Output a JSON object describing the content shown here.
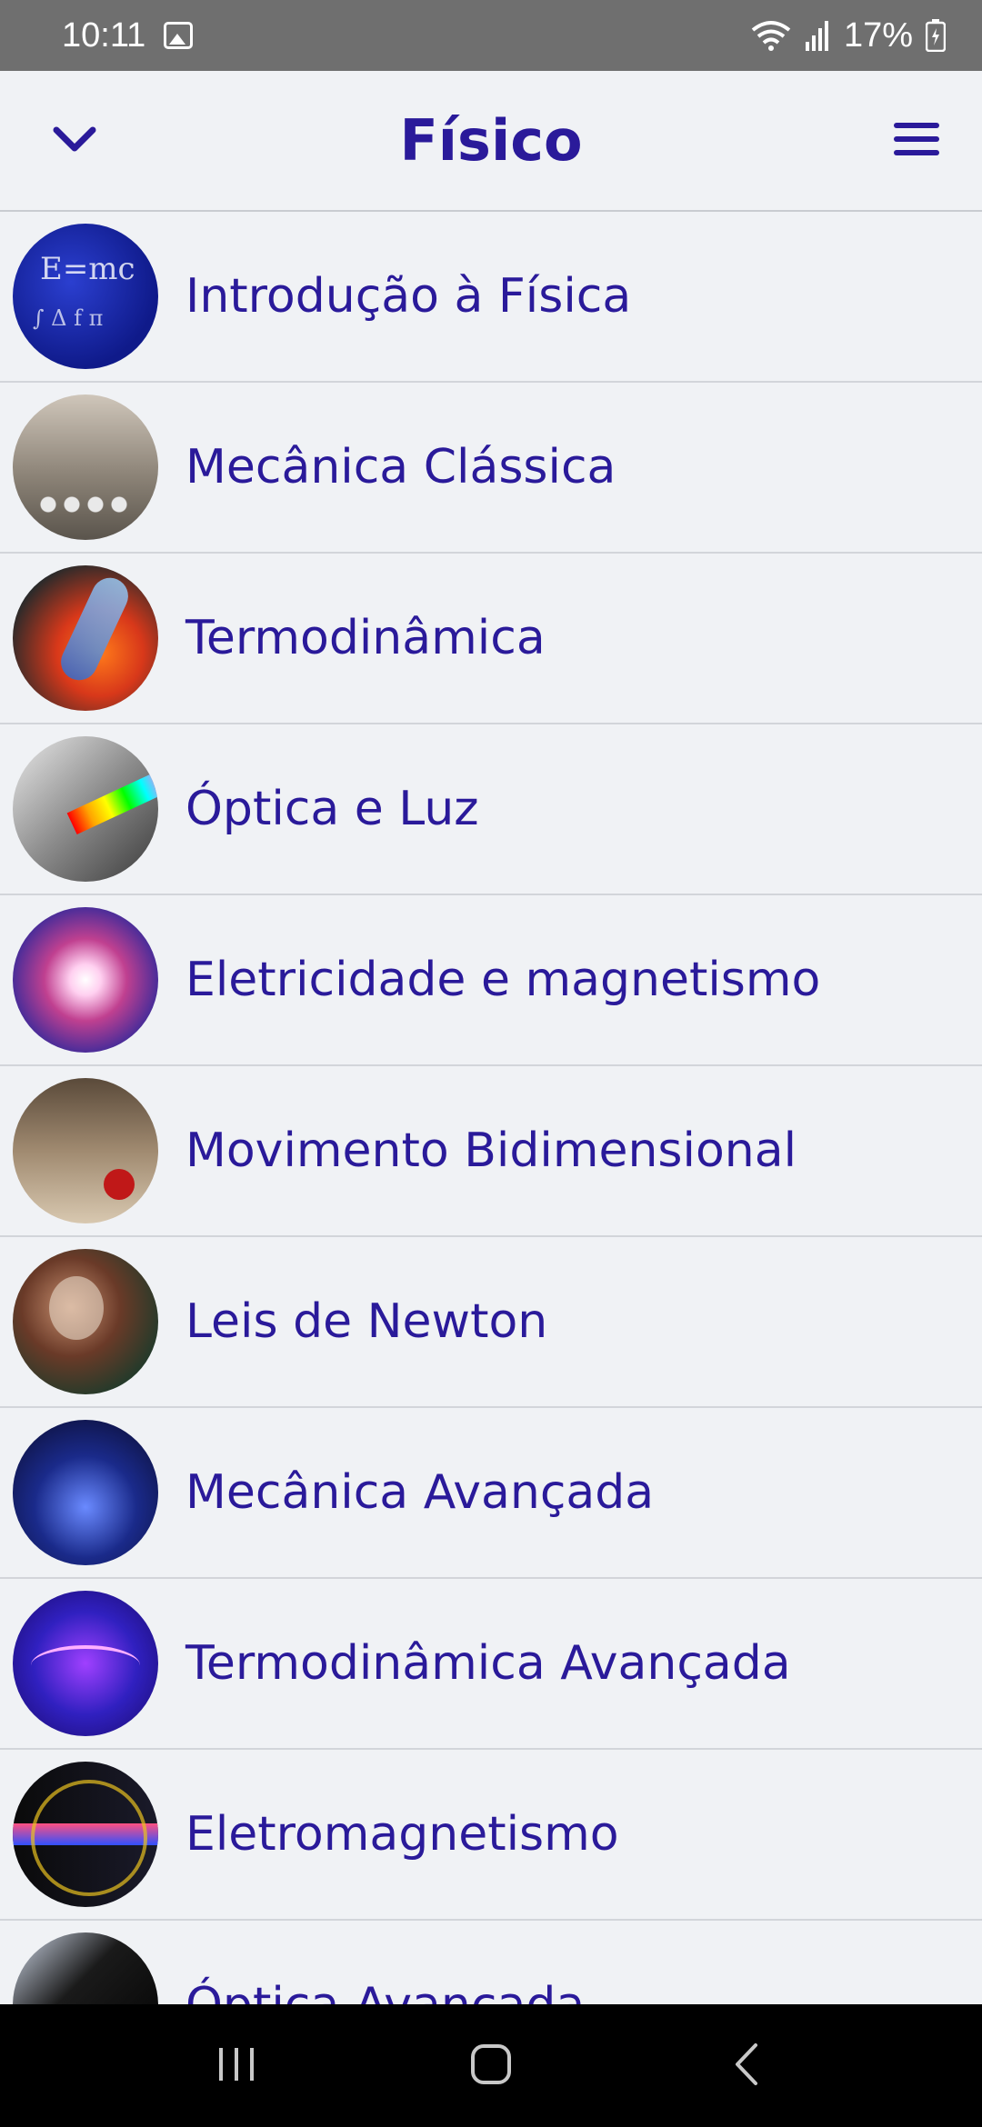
{
  "status_bar": {
    "time": "10:11",
    "battery_percent": "17%",
    "icons": [
      "gallery-icon",
      "wifi-icon",
      "signal-icon",
      "battery-icon"
    ]
  },
  "header": {
    "title": "Físico",
    "left_icon": "chevron-down-icon",
    "right_icon": "hamburger-menu-icon"
  },
  "colors": {
    "accent": "#2a1a9a",
    "background": "#f0f2f5",
    "status_bar": "#6f6f6f",
    "nav_bar": "#000000"
  },
  "topics": [
    {
      "label": "Introdução à Física"
    },
    {
      "label": "Mecânica Clássica"
    },
    {
      "label": "Termodinâmica"
    },
    {
      "label": "Óptica e Luz"
    },
    {
      "label": "Eletricidade e magnetismo"
    },
    {
      "label": "Movimento Bidimensional"
    },
    {
      "label": "Leis de Newton"
    },
    {
      "label": "Mecânica Avançada"
    },
    {
      "label": "Termodinâmica Avançada"
    },
    {
      "label": "Eletromagnetismo"
    },
    {
      "label": "Óptica Avançada"
    }
  ],
  "nav_bar": {
    "buttons": [
      "recent-apps-icon",
      "home-icon",
      "back-icon"
    ]
  }
}
